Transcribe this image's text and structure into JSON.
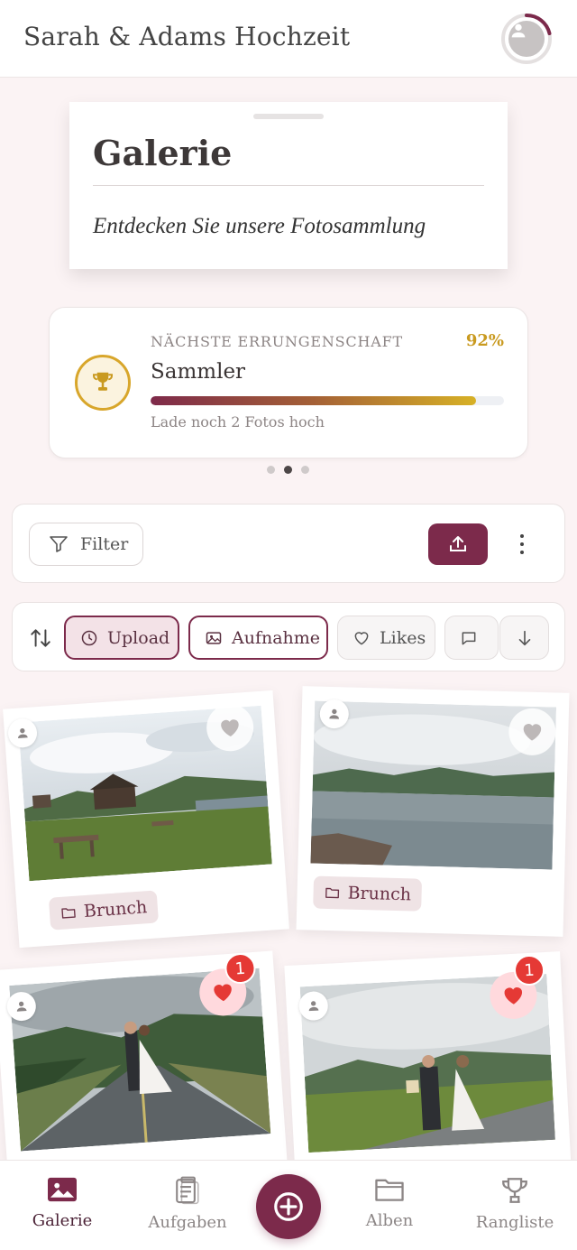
{
  "header": {
    "title": "Sarah & Adams Hochzeit",
    "avatar_icon": "user-avatar-icon",
    "progress_ring_color": "#7c2a4b"
  },
  "gallery_card": {
    "title": "Galerie",
    "subtitle": "Entdecken Sie unsere Fotosammlung"
  },
  "achievement": {
    "label": "NÄCHSTE ERRUNGENSCHAFT",
    "percent": "92%",
    "name": "Sammler",
    "hint": "Lade noch 2 Fotos hoch",
    "progress_fraction": 0.92,
    "icon": "trophy-icon",
    "accent": "#d8a62b"
  },
  "carousel": {
    "pages": 3,
    "active_index": 1
  },
  "toolbar": {
    "filter_label": "Filter",
    "upload_icon": "upload-icon",
    "more_icon": "more-vertical-icon",
    "accent": "#7c2a4b"
  },
  "sort": {
    "icon": "sort-icon",
    "chips": [
      {
        "label": "Upload",
        "icon": "clock-icon",
        "selected": true
      },
      {
        "label": "Aufnahme",
        "icon": "image-icon",
        "selected": true
      },
      {
        "label": "Likes",
        "icon": "heart-outline-icon",
        "selected": false
      },
      {
        "label": "",
        "icon": "comment-icon",
        "selected": false
      },
      {
        "label": "",
        "icon": "arrow-down-icon",
        "selected": false
      }
    ]
  },
  "photos": [
    {
      "album": "Brunch",
      "liked": false,
      "likes": "",
      "scene": "cabin by lake with picnic table"
    },
    {
      "album": "Brunch",
      "liked": false,
      "likes": "",
      "scene": "mountain lake"
    },
    {
      "album": "",
      "liked": true,
      "likes": "1",
      "scene": "couple kissing on road"
    },
    {
      "album": "",
      "liked": true,
      "likes": "1",
      "scene": "couple walking on road"
    }
  ],
  "nav": {
    "items": [
      {
        "label": "Galerie",
        "icon": "gallery-icon",
        "active": true
      },
      {
        "label": "Aufgaben",
        "icon": "clipboard-icon",
        "active": false
      },
      {
        "label": "Alben",
        "icon": "folder-icon",
        "active": false
      },
      {
        "label": "Rangliste",
        "icon": "trophy-icon",
        "active": false
      }
    ],
    "fab_icon": "plus-circle-icon"
  }
}
